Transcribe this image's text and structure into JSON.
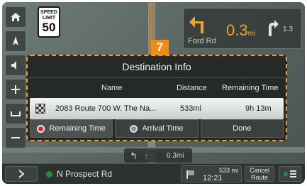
{
  "speed_sign": {
    "label": "SPEED LIMIT",
    "value": "50"
  },
  "turn": {
    "distance": "0.3",
    "unit": "mi",
    "road": "Ford Rd",
    "next_distance": "1.3"
  },
  "marker": "7",
  "dialog": {
    "title": "Destination Info",
    "columns": {
      "name": "Name",
      "distance": "Distance",
      "remaining": "Remaining Time"
    },
    "row": {
      "name": "2083 Route 700 W. The Na...",
      "distance": "533mi",
      "remaining": "9h 13m"
    },
    "buttons": {
      "remaining": "Remaining Time",
      "arrival": "Arrival Time",
      "done": "Done"
    }
  },
  "lane": {
    "distance": "0.3mi"
  },
  "bottom": {
    "road": "N Prospect Rd",
    "eta_distance": "533 mi",
    "eta_time": "12:21",
    "cancel": "Cancel Route"
  },
  "colors": {
    "accent": "#f0a020",
    "route": "#d37a1f",
    "radio_on": "#d8282a"
  }
}
